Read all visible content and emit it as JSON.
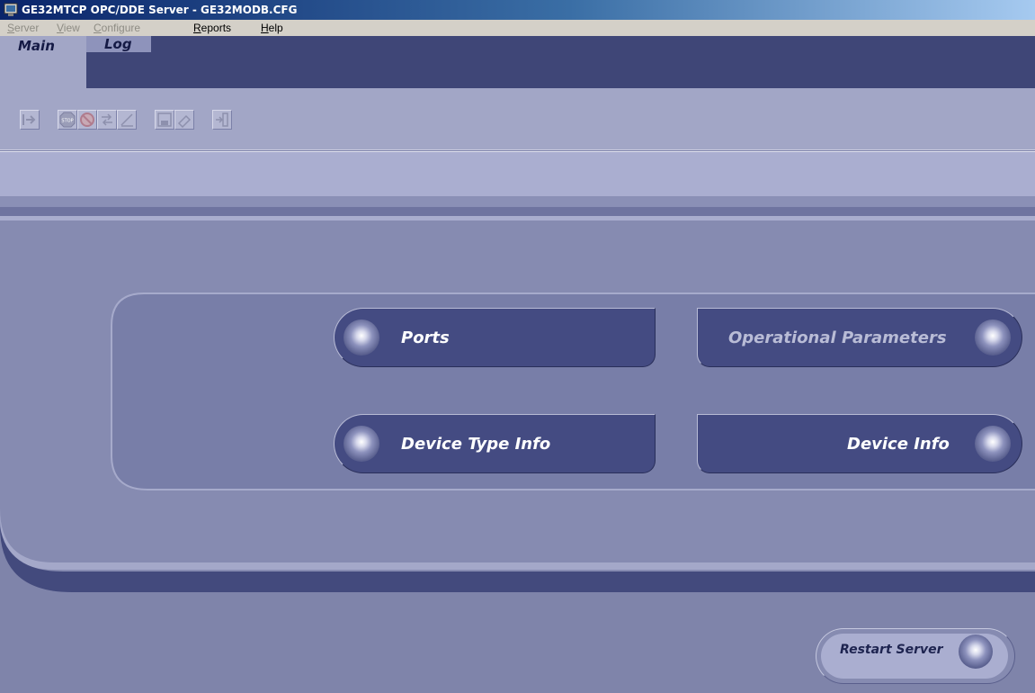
{
  "window": {
    "title": "GE32MTCP OPC/DDE Server - GE32MODB.CFG"
  },
  "menubar": {
    "items": [
      {
        "label": "Server",
        "enabled": false
      },
      {
        "label": "View",
        "enabled": false
      },
      {
        "label": "Configure",
        "enabled": false
      },
      {
        "label": "Reports",
        "enabled": true
      },
      {
        "label": "Help",
        "enabled": true
      }
    ]
  },
  "tabs": [
    {
      "label": "Main",
      "selected": true
    },
    {
      "label": "Log",
      "selected": false
    }
  ],
  "toolbar": {
    "buttons": [
      {
        "icon": "start-icon"
      },
      {
        "icon": "stop-icon"
      },
      {
        "icon": "disable-icon"
      },
      {
        "icon": "transfer-icon"
      },
      {
        "icon": "edit-icon"
      },
      {
        "icon": "save-icon"
      },
      {
        "icon": "print-icon"
      },
      {
        "icon": "exit-icon"
      }
    ]
  },
  "main": {
    "buttons": {
      "ports": "Ports",
      "operational_parameters": "Operational Parameters",
      "device_type_info": "Device Type Info",
      "device_info": "Device Info"
    },
    "restart_label": "Restart Server"
  },
  "colors": {
    "panel": "#868bb1",
    "button": "#444b82",
    "tabstrip": "#3f4677"
  }
}
